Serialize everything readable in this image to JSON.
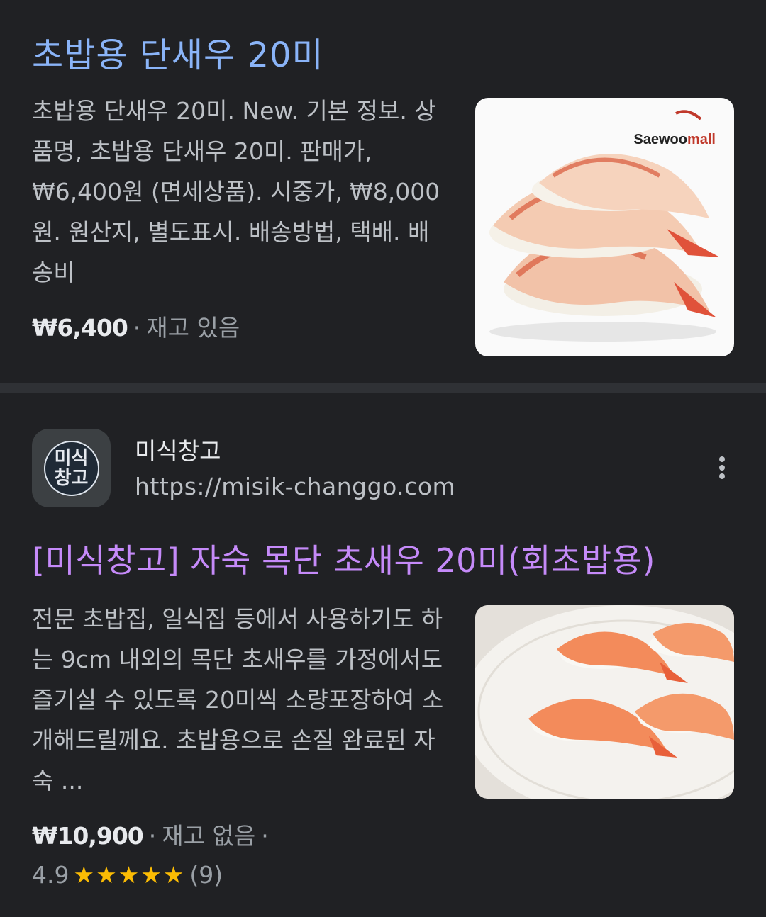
{
  "result1": {
    "title": "초밥용 단새우 20미",
    "snippet": "초밥용 단새우 20미. New. 기본 정보. 상품명, 초밥용 단새우 20미. 판매가, ₩6,400원 (면세상품). 시중가, ₩8,000원. 원산지, 별도표시. 배송방법, 택배. 배송비",
    "price": "₩6,400",
    "stock": "재고 있음",
    "image_brand_prefix": "Saewoo",
    "image_brand_suffix": "mall"
  },
  "result2": {
    "site_name": "미식창고",
    "site_url": "https://misik-changgo.com",
    "favicon_line1": "미식",
    "favicon_line2": "창고",
    "title": "[미식창고] 자숙 목단 초새우 20미(회초밥용)",
    "snippet": "전문 초밥집, 일식집 등에서 사용하기도 하는 9cm 내외의 목단 초새우를 가정에서도 즐기실 수 있도록 20미씩 소량포장하여 소개해드릴께요. 초밥용으로 손질 완료된 자숙 ...",
    "price": "₩10,900",
    "stock": "재고 없음",
    "rating": "4.9",
    "rating_value": 4.9,
    "rating_max": 5,
    "stars": "★★★★★",
    "review_count": "(9)"
  },
  "colors": {
    "background": "#202124",
    "link_blue": "#8ab4f8",
    "visited_purple": "#c58af9",
    "star": "#fbbc04"
  },
  "icons": {
    "more": "more-vert-icon"
  }
}
